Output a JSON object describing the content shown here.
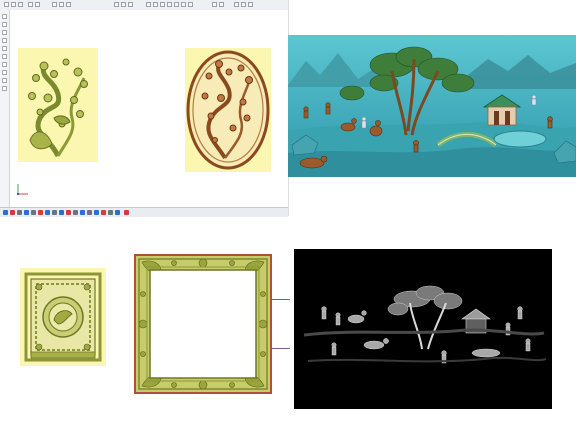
{
  "cad_window": {
    "toolbar_top": [
      "new",
      "open",
      "save",
      "undo",
      "redo",
      "cut",
      "copy",
      "paste",
      "zoom",
      "pan",
      "select",
      "move",
      "rotate",
      "mirror",
      "scale",
      "fillet",
      "trim",
      "extend"
    ],
    "left_tools": [
      "line",
      "arc",
      "circle",
      "rect",
      "polygon",
      "spline",
      "text",
      "dimension",
      "hatch",
      "node"
    ],
    "bottom_tools": [
      "select",
      "move",
      "copy",
      "rotate",
      "scale",
      "mirror",
      "array",
      "offset",
      "trim",
      "extend",
      "fillet",
      "chamfer",
      "break",
      "join",
      "explode",
      "measure",
      "layers",
      "delete"
    ]
  },
  "colors": {
    "canvas_bg": "#ffffff",
    "panel_yellow": "#fbf6b0",
    "relief_green": "#9aa83c",
    "relief_brown": "#9a5a2c",
    "relief_teal": "#48b7c4",
    "bottom_toolbar_accent": "#d43c3c",
    "bottom_toolbar_blue": "#2b6fd6"
  },
  "icons": {
    "ucs": "ucs-axis-icon",
    "close": "close-icon"
  }
}
